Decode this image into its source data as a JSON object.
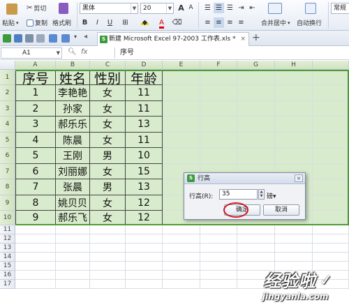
{
  "ribbon": {
    "paste": "粘贴",
    "cut": "剪切",
    "copy": "复制",
    "format_painter": "格式刷",
    "font_name": "黑体",
    "font_size": "20",
    "bold": "B",
    "italic": "I",
    "underline": "U",
    "merge_center": "合并居中",
    "wrap_text": "自动换行",
    "normal": "常规"
  },
  "tabbar": {
    "doc_tab": "新建 Microsoft Excel 97-2003 工作表.xls *",
    "tab_close": "×",
    "add_tab": "+"
  },
  "formula_bar": {
    "cell_ref": "A1",
    "fx": "fx",
    "content": "序号"
  },
  "columns": [
    "A",
    "B",
    "C",
    "D",
    "E",
    "F",
    "G",
    "H"
  ],
  "rows": [
    "1",
    "2",
    "3",
    "4",
    "5",
    "6",
    "7",
    "8",
    "9",
    "10",
    "11",
    "12",
    "13",
    "14",
    "15",
    "16",
    "17"
  ],
  "table": {
    "headers": [
      "序号",
      "姓名",
      "性别",
      "年龄"
    ],
    "rows": [
      [
        "1",
        "李艳艳",
        "女",
        "11"
      ],
      [
        "2",
        "孙家",
        "女",
        "11"
      ],
      [
        "3",
        "郝乐乐",
        "女",
        "13"
      ],
      [
        "4",
        "陈晨",
        "女",
        "11"
      ],
      [
        "5",
        "王刚",
        "男",
        "10"
      ],
      [
        "6",
        "刘丽娜",
        "女",
        "15"
      ],
      [
        "7",
        "张晨",
        "男",
        "13"
      ],
      [
        "8",
        "姚贝贝",
        "女",
        "12"
      ],
      [
        "9",
        "郝乐飞",
        "女",
        "12"
      ]
    ]
  },
  "dialog": {
    "title": "行高",
    "close": "×",
    "label": "行高(R):",
    "value": "35",
    "unit": "磅▾",
    "ok": "确定",
    "cancel": "取消"
  },
  "watermark": {
    "cn": "经验啦",
    "en": "jingyanla.com",
    "check": "✓"
  },
  "colors": {
    "selection_fill": "#d8ebcc",
    "selection_border": "#4e9a39",
    "highlight_ring": "#d4141c"
  }
}
